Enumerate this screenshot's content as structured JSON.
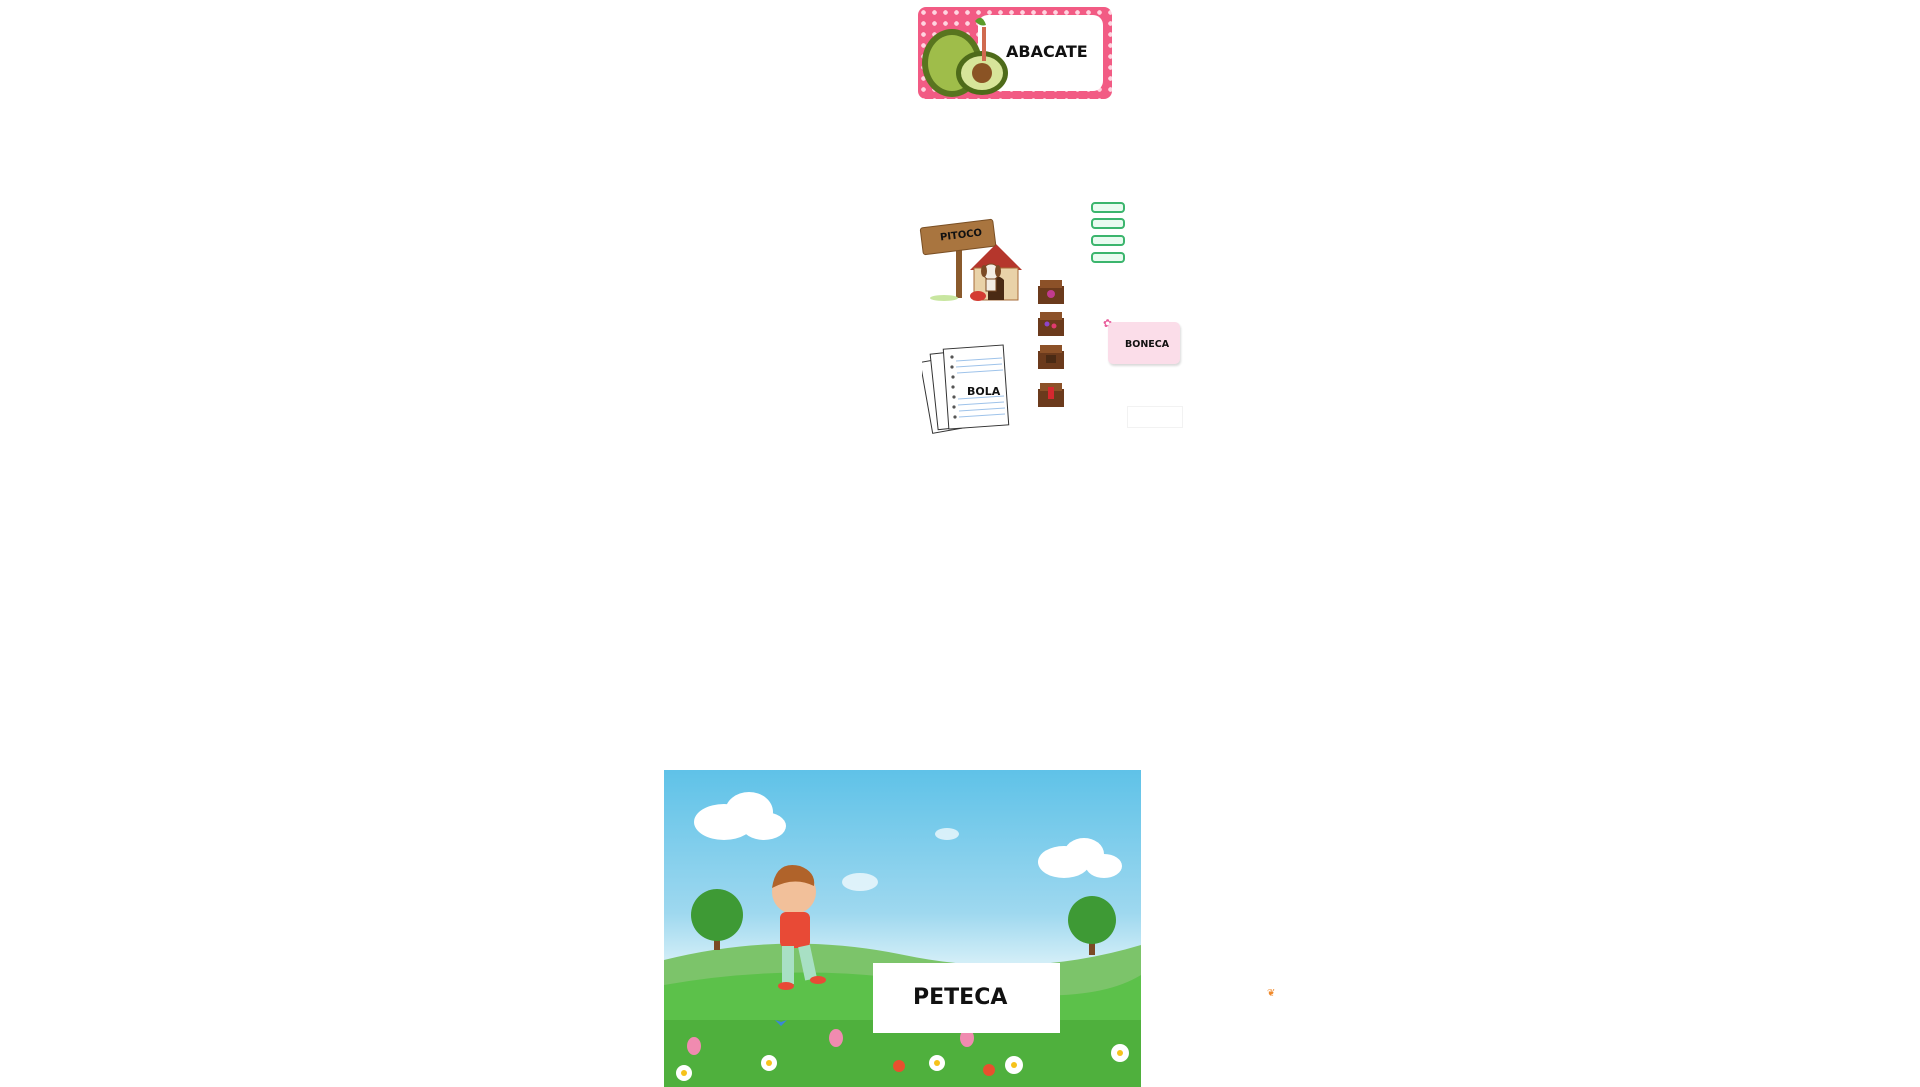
{
  "cards": {
    "abacate": {
      "label": "ABACATE"
    },
    "pitoco": {
      "label": "PITOCO"
    },
    "bola": {
      "label": "BOLA"
    },
    "boneca": {
      "label": "BONECA"
    },
    "peteca": {
      "label": "PETECA"
    }
  },
  "colors": {
    "card_pink": "#f25b84",
    "bar_green": "#3bb56d",
    "boneca_bg": "#fbdde9",
    "sky": "#5fc2e8",
    "grass": "#5cc14a"
  },
  "icons": [
    "avocado-icon",
    "doghouse-icon",
    "dog-icon",
    "papers-icon",
    "chest-icon",
    "flower-icon",
    "boy-icon",
    "butterfly-icon",
    "cloud-icon",
    "tree-icon"
  ]
}
